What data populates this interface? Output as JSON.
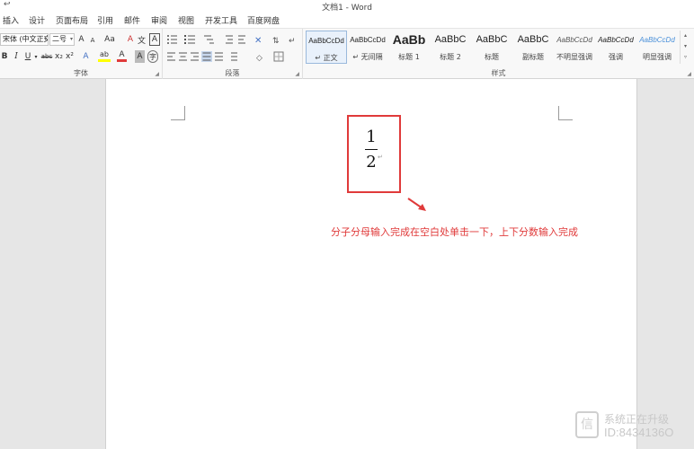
{
  "window": {
    "title": "文档1 - Word",
    "quick_access_glyph": "↩"
  },
  "tabs": [
    "插入",
    "设计",
    "页面布局",
    "引用",
    "邮件",
    "审阅",
    "视图",
    "开发工具",
    "百度网盘"
  ],
  "font_group": {
    "label": "字体",
    "font_name": "宋体 (中文正文)",
    "font_size": "二号",
    "grow_glyph": "A",
    "shrink_glyph": "A",
    "case_glyph": "Aa",
    "clear_glyph": "A",
    "pinyin_glyph": "文",
    "border_glyph": "A",
    "bold": "B",
    "italic": "I",
    "underline": "U",
    "strike": "abc",
    "sub": "x₂",
    "sup": "x²",
    "effects_glyph": "A",
    "highlight_glyph": "ab",
    "color_glyph": "A",
    "shading_glyph": "A",
    "enclose_glyph": "字",
    "highlight_color": "#ffff00",
    "font_color": "#e03a3a"
  },
  "paragraph_group": {
    "label": "段落"
  },
  "styles_group": {
    "label": "样式",
    "items": [
      {
        "sample": "AaBbCcDd",
        "name": "↵ 正文"
      },
      {
        "sample": "AaBbCcDd",
        "name": "↵ 无间隔"
      },
      {
        "sample": "AaBb",
        "name": "标题 1"
      },
      {
        "sample": "AaBbC",
        "name": "标题 2"
      },
      {
        "sample": "AaBbC",
        "name": "标题"
      },
      {
        "sample": "AaBbC",
        "name": "副标题"
      },
      {
        "sample": "AaBbCcDd",
        "name": "不明显强调"
      },
      {
        "sample": "AaBbCcDd",
        "name": "强调"
      },
      {
        "sample": "AaBbCcDd",
        "name": "明显强调"
      }
    ]
  },
  "document": {
    "fraction": {
      "numerator": "1",
      "denominator": "2"
    },
    "paragraph_mark": "↵",
    "annotation": "分子分母输入完成在空白处单击一下，上下分数输入完成",
    "annotation_color": "#e03a3a"
  },
  "watermark": {
    "line1": "系统正在升级",
    "line2": "ID:8434136O",
    "logo_glyph": "信"
  }
}
